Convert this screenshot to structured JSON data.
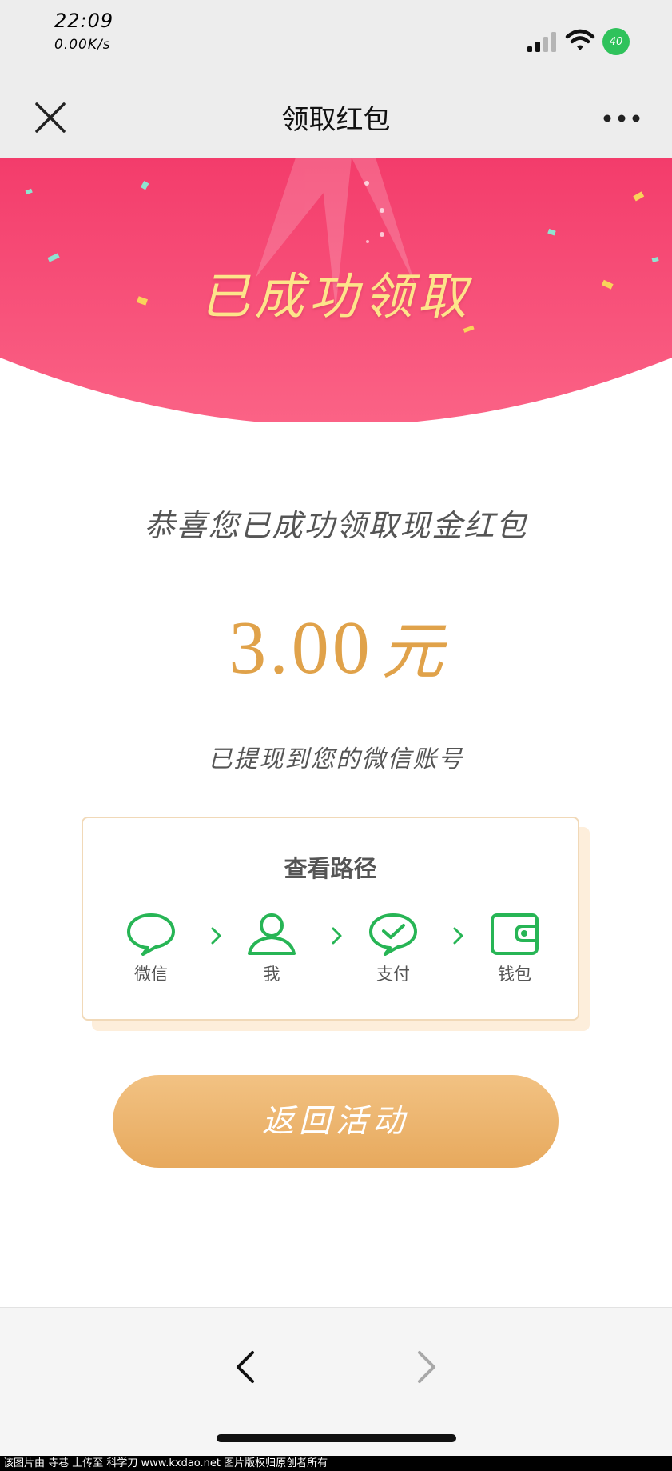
{
  "status_bar": {
    "time": "22:09",
    "speed": "0.00K/s",
    "battery": "40"
  },
  "nav": {
    "title": "领取红包"
  },
  "banner": {
    "title": "已成功领取"
  },
  "main": {
    "congrats": "恭喜您已成功领取现金红包",
    "amount": "3.00",
    "amount_unit": "元",
    "withdraw_note": "已提现到您的微信账号"
  },
  "path_card": {
    "title": "查看路径",
    "steps": [
      {
        "label": "微信",
        "icon": "chat-bubble-icon"
      },
      {
        "label": "我",
        "icon": "user-icon"
      },
      {
        "label": "支付",
        "icon": "pay-check-icon"
      },
      {
        "label": "钱包",
        "icon": "wallet-icon"
      }
    ]
  },
  "actions": {
    "back_to_activity": "返回活动"
  },
  "footer": {
    "caption": "该图片由 寺巷 上传至 科学刀 www.kxdao.net 图片版权归原创者所有"
  },
  "colors": {
    "banner": "#f8527a",
    "banner_title": "#fde48a",
    "amount": "#e0a24a",
    "wechat_green": "#27b555",
    "button": "#eeb56e"
  }
}
